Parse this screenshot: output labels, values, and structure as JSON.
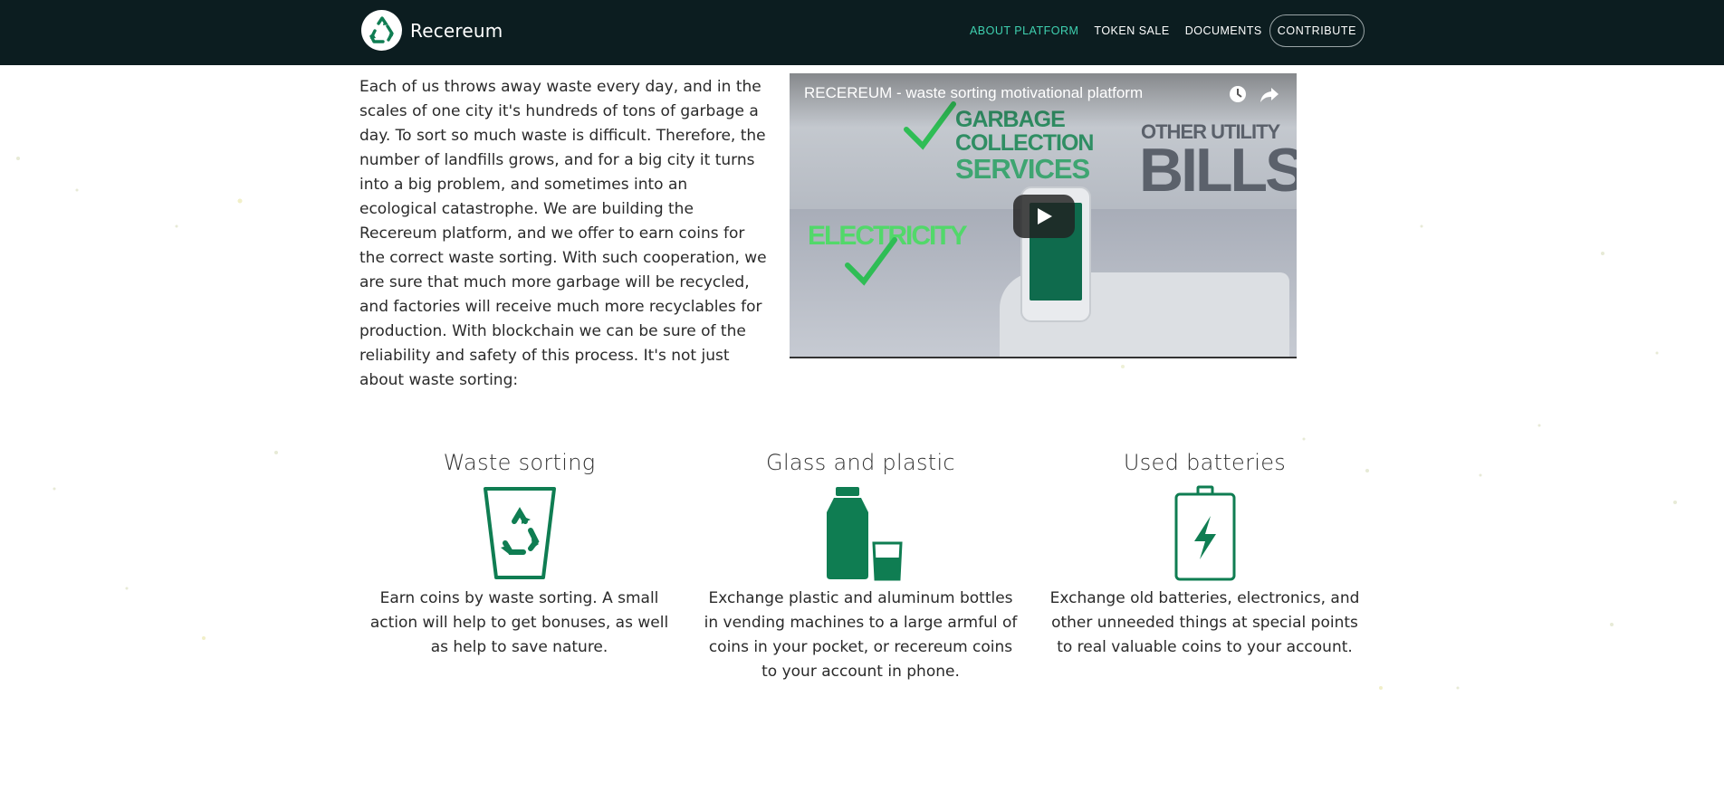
{
  "header": {
    "brand": "Recereum",
    "nav": [
      {
        "label": "ABOUT PLATFORM",
        "active": true
      },
      {
        "label": "TOKEN SALE",
        "active": false
      },
      {
        "label": "DOCUMENTS",
        "active": false
      }
    ],
    "contribute_label": "CONTRIBUTE"
  },
  "intro": {
    "text": "Each of us throws away waste every day, and in the scales of one city it's hundreds of tons of garbage a day. To sort so much waste is difficult. Therefore, the number of landfills grows, and for a big city it turns into a big problem, and sometimes into an ecological catastrophe. We are building the Recereum platform, and we offer to earn coins for the correct waste sorting. With such cooperation, we are sure that much more garbage will be recycled, and factories will receive much more recyclables for production. With blockchain we can be sure of the reliability and safety of this process. It's not just about waste sorting:"
  },
  "video": {
    "title": "RECEREUM - waste sorting motivational platform",
    "scene_text": {
      "garbage_line1": "GARBAGE",
      "garbage_line2": "COLLECTION",
      "garbage_line3": "SERVICES",
      "other_utility": "OTHER UTILITY",
      "bills": "BILLS",
      "electricity": "ELECTRICITY"
    },
    "icons": {
      "watch_later": "clock-icon",
      "share": "share-arrow-icon",
      "play": "play-icon"
    }
  },
  "features": [
    {
      "title": "Waste sorting",
      "icon": "recycle-bin-icon",
      "description": "Earn coins by waste sorting. A small action will help to get bonuses, as well as help to save nature."
    },
    {
      "title": "Glass and plastic",
      "icon": "bottle-glass-icon",
      "description": "Exchange plastic and aluminum bottles in vending machines to a large armful of coins in your pocket, or recereum coins to your account in phone."
    },
    {
      "title": "Used batteries",
      "icon": "battery-icon",
      "description": "Exchange old batteries, electronics, and other unneeded things at special points to real valuable coins to your account."
    }
  ],
  "colors": {
    "navbar_bg": "#0c1d20",
    "accent": "#3fd1b0",
    "icon_green": "#0f7d52"
  }
}
